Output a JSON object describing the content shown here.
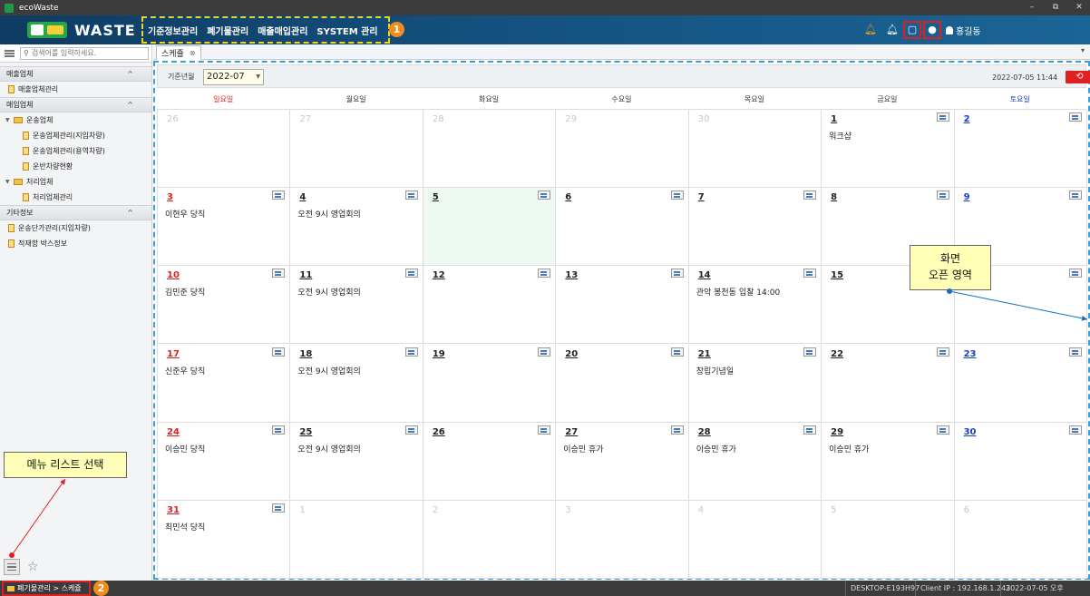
{
  "window": {
    "title": "ecoWaste",
    "controls": [
      "–",
      "⧉",
      "✕"
    ]
  },
  "header": {
    "logo_badge": "DO WELL ECO",
    "brand": "WASTE",
    "menus": [
      "기준정보관리",
      "폐기물관리",
      "매출매입관리",
      "SYSTEM 관리"
    ],
    "user": "홍길동"
  },
  "markers": [
    "1",
    "2",
    "3",
    "4"
  ],
  "sidebar": {
    "search_placeholder": "검색어를 입력하세요.",
    "sections": [
      {
        "title": "매출업체",
        "items": [
          "매출업체관리"
        ]
      },
      {
        "title": "매입업체",
        "groups": [
          {
            "title": "운송업체",
            "items": [
              "운송업체관리(지입차량)",
              "운송업체관리(용역차량)",
              "운반차량현황"
            ]
          },
          {
            "title": "처리업체",
            "items": [
              "처리업체관리"
            ]
          }
        ]
      },
      {
        "title": "기타정보",
        "items": [
          "운송단가관리(지입차량)",
          "적재함 박스정보"
        ]
      }
    ]
  },
  "tabs": [
    {
      "label": "스케쥴"
    }
  ],
  "toolbar": {
    "base_month_label": "기준년월",
    "base_month_value": "2022-07",
    "datetime": "2022-07-05 11:44"
  },
  "calendar": {
    "weekdays": [
      "일요일",
      "월요일",
      "화요일",
      "수요일",
      "목요일",
      "금요일",
      "토요일"
    ],
    "weeks": [
      [
        {
          "d": "26",
          "o": true
        },
        {
          "d": "27",
          "o": true
        },
        {
          "d": "28",
          "o": true
        },
        {
          "d": "29",
          "o": true
        },
        {
          "d": "30",
          "o": true
        },
        {
          "d": "1",
          "e": "워크샵"
        },
        {
          "d": "2"
        }
      ],
      [
        {
          "d": "3",
          "e": "이현우 당직"
        },
        {
          "d": "4",
          "e": "오전 9시 영업회의"
        },
        {
          "d": "5",
          "today": true
        },
        {
          "d": "6"
        },
        {
          "d": "7"
        },
        {
          "d": "8"
        },
        {
          "d": "9"
        }
      ],
      [
        {
          "d": "10",
          "e": "김민준 당직"
        },
        {
          "d": "11",
          "e": "오전 9시 영업회의"
        },
        {
          "d": "12"
        },
        {
          "d": "13"
        },
        {
          "d": "14",
          "e": "관악 봉천동 입찰 14:00"
        },
        {
          "d": "15"
        },
        {
          "d": "16"
        }
      ],
      [
        {
          "d": "17",
          "e": "신준우 당직"
        },
        {
          "d": "18",
          "e": "오전 9시 영업회의"
        },
        {
          "d": "19"
        },
        {
          "d": "20"
        },
        {
          "d": "21",
          "e": "창립기념일"
        },
        {
          "d": "22"
        },
        {
          "d": "23"
        }
      ],
      [
        {
          "d": "24",
          "e": "이승민 당직"
        },
        {
          "d": "25",
          "e": "오전 9시 영업회의"
        },
        {
          "d": "26"
        },
        {
          "d": "27",
          "e": "이승민 휴가"
        },
        {
          "d": "28",
          "e": "이승민 휴가"
        },
        {
          "d": "29",
          "e": "이승민 휴가"
        },
        {
          "d": "30"
        }
      ],
      [
        {
          "d": "31",
          "e": "최민석 당직"
        },
        {
          "d": "1",
          "o": true
        },
        {
          "d": "2",
          "o": true
        },
        {
          "d": "3",
          "o": true
        },
        {
          "d": "4",
          "o": true
        },
        {
          "d": "5",
          "o": true
        },
        {
          "d": "6",
          "o": true
        }
      ]
    ]
  },
  "callouts": {
    "screen_area_line1": "화면",
    "screen_area_line2": "오픈 영역",
    "menu_list": "메뉴 리스트 선택"
  },
  "statusbar": {
    "breadcrumb": "폐기물관리 > 스케쥴",
    "machine": "DESKTOP-E193H97",
    "client_ip": "Client IP : 192.168.1.243",
    "datetime": "2022-07-05 오후 5:20:12"
  }
}
